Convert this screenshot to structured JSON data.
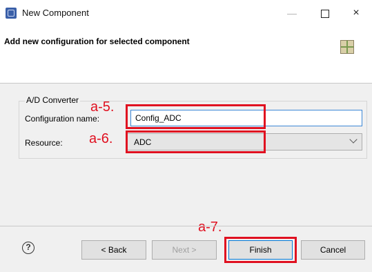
{
  "window": {
    "title": "New Component",
    "minimize": "—",
    "close": "×"
  },
  "header": {
    "title": "Add new configuration for selected component"
  },
  "group": {
    "label": "A/D Converter"
  },
  "form": {
    "config_name_label": "Configuration name:",
    "config_name_value": "Config_ADC",
    "resource_label": "Resource:",
    "resource_value": "ADC"
  },
  "annotations": {
    "a5": "a-5.",
    "a6": "a-6.",
    "a7": "a-7."
  },
  "footer": {
    "help": "?",
    "back": "< Back",
    "next": "Next >",
    "finish": "Finish",
    "cancel": "Cancel"
  },
  "colors": {
    "annotation": "#e01020",
    "input_focus": "#3b87d6",
    "default_button_border": "#0078d7"
  }
}
